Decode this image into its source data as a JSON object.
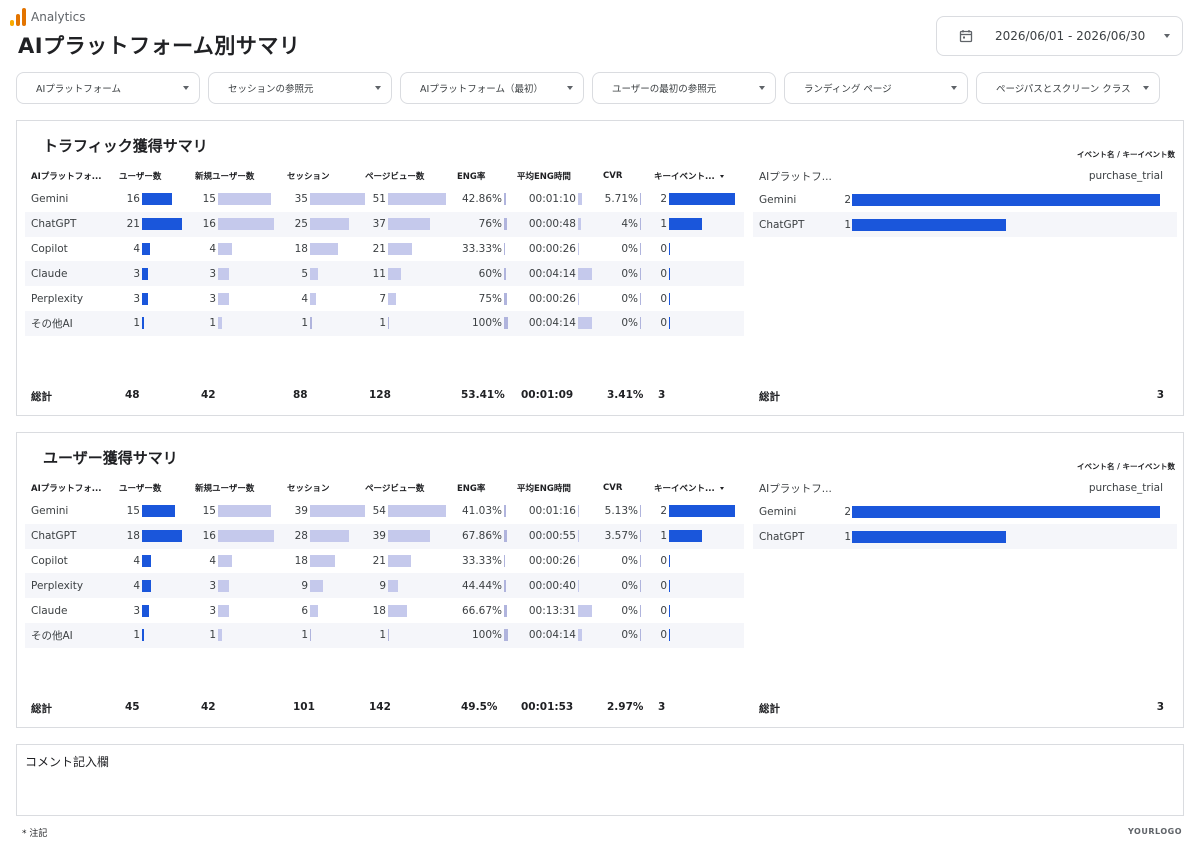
{
  "app": {
    "name": "Analytics"
  },
  "page": {
    "title": "AIプラットフォーム別サマリ"
  },
  "date_range": {
    "value": "2026/06/01 - 2026/06/30"
  },
  "filters": [
    "AIプラットフォーム",
    "セッションの参照元",
    "AIプラットフォーム（最初）",
    "ユーザーの最初の参照元",
    "ランディング ページ",
    "ページパスとスクリーン クラス"
  ],
  "columns": [
    "AIプラットフォ...",
    "ユーザー数",
    "新規ユーザー数",
    "セッション",
    "ページビュー数",
    "ENG率",
    "平均ENG時間",
    "CVR",
    "キーイベント..."
  ],
  "side_header": {
    "event_title": "イベント名 / キーイベント数",
    "col1": "AIプラットフ...",
    "col2": "purchase_trial"
  },
  "sections": [
    {
      "title": "トラフィック獲得サマリ",
      "rows": [
        {
          "name": "Gemini",
          "users": 16,
          "new_users": 15,
          "sessions": 35,
          "pageviews": 51,
          "eng_rate": "42.86%",
          "eng_rate_value": 42.86,
          "avg_time": "00:01:10",
          "avg_time_sec": 70,
          "cvr": "5.71%",
          "cvr_value": 5.71,
          "key_events": 2
        },
        {
          "name": "ChatGPT",
          "users": 21,
          "new_users": 16,
          "sessions": 25,
          "pageviews": 37,
          "eng_rate": "76%",
          "eng_rate_value": 76,
          "avg_time": "00:00:48",
          "avg_time_sec": 48,
          "cvr": "4%",
          "cvr_value": 4,
          "key_events": 1
        },
        {
          "name": "Copilot",
          "users": 4,
          "new_users": 4,
          "sessions": 18,
          "pageviews": 21,
          "eng_rate": "33.33%",
          "eng_rate_value": 33.33,
          "avg_time": "00:00:26",
          "avg_time_sec": 26,
          "cvr": "0%",
          "cvr_value": 0,
          "key_events": 0
        },
        {
          "name": "Claude",
          "users": 3,
          "new_users": 3,
          "sessions": 5,
          "pageviews": 11,
          "eng_rate": "60%",
          "eng_rate_value": 60,
          "avg_time": "00:04:14",
          "avg_time_sec": 254,
          "cvr": "0%",
          "cvr_value": 0,
          "key_events": 0
        },
        {
          "name": "Perplexity",
          "users": 3,
          "new_users": 3,
          "sessions": 4,
          "pageviews": 7,
          "eng_rate": "75%",
          "eng_rate_value": 75,
          "avg_time": "00:00:26",
          "avg_time_sec": 26,
          "cvr": "0%",
          "cvr_value": 0,
          "key_events": 0
        },
        {
          "name": "その他AI",
          "users": 1,
          "new_users": 1,
          "sessions": 1,
          "pageviews": 1,
          "eng_rate": "100%",
          "eng_rate_value": 100,
          "avg_time": "00:04:14",
          "avg_time_sec": 254,
          "cvr": "0%",
          "cvr_value": 0,
          "key_events": 0
        }
      ],
      "totals": {
        "label": "総計",
        "users": "48",
        "new_users": "42",
        "sessions": "88",
        "pageviews": "128",
        "eng_rate": "53.41%",
        "avg_time": "00:01:09",
        "cvr": "3.41%",
        "key_events": "3"
      },
      "side_rows": [
        {
          "name": "Gemini",
          "value": 2
        },
        {
          "name": "ChatGPT",
          "value": 1
        }
      ],
      "side_total": {
        "label": "総計",
        "value": "3"
      }
    },
    {
      "title": "ユーザー獲得サマリ",
      "rows": [
        {
          "name": "Gemini",
          "users": 15,
          "new_users": 15,
          "sessions": 39,
          "pageviews": 54,
          "eng_rate": "41.03%",
          "eng_rate_value": 41.03,
          "avg_time": "00:01:16",
          "avg_time_sec": 76,
          "cvr": "5.13%",
          "cvr_value": 5.13,
          "key_events": 2
        },
        {
          "name": "ChatGPT",
          "users": 18,
          "new_users": 16,
          "sessions": 28,
          "pageviews": 39,
          "eng_rate": "67.86%",
          "eng_rate_value": 67.86,
          "avg_time": "00:00:55",
          "avg_time_sec": 55,
          "cvr": "3.57%",
          "cvr_value": 3.57,
          "key_events": 1
        },
        {
          "name": "Copilot",
          "users": 4,
          "new_users": 4,
          "sessions": 18,
          "pageviews": 21,
          "eng_rate": "33.33%",
          "eng_rate_value": 33.33,
          "avg_time": "00:00:26",
          "avg_time_sec": 26,
          "cvr": "0%",
          "cvr_value": 0,
          "key_events": 0
        },
        {
          "name": "Perplexity",
          "users": 4,
          "new_users": 3,
          "sessions": 9,
          "pageviews": 9,
          "eng_rate": "44.44%",
          "eng_rate_value": 44.44,
          "avg_time": "00:00:40",
          "avg_time_sec": 40,
          "cvr": "0%",
          "cvr_value": 0,
          "key_events": 0
        },
        {
          "name": "Claude",
          "users": 3,
          "new_users": 3,
          "sessions": 6,
          "pageviews": 18,
          "eng_rate": "66.67%",
          "eng_rate_value": 66.67,
          "avg_time": "00:13:31",
          "avg_time_sec": 811,
          "cvr": "0%",
          "cvr_value": 0,
          "key_events": 0
        },
        {
          "name": "その他AI",
          "users": 1,
          "new_users": 1,
          "sessions": 1,
          "pageviews": 1,
          "eng_rate": "100%",
          "eng_rate_value": 100,
          "avg_time": "00:04:14",
          "avg_time_sec": 254,
          "cvr": "0%",
          "cvr_value": 0,
          "key_events": 0
        }
      ],
      "totals": {
        "label": "総計",
        "users": "45",
        "new_users": "42",
        "sessions": "101",
        "pageviews": "142",
        "eng_rate": "49.5%",
        "avg_time": "00:01:53",
        "cvr": "2.97%",
        "key_events": "3"
      },
      "side_rows": [
        {
          "name": "Gemini",
          "value": 2
        },
        {
          "name": "ChatGPT",
          "value": 1
        }
      ],
      "side_total": {
        "label": "総計",
        "value": "3"
      }
    }
  ],
  "comment": {
    "label": "コメント記入欄"
  },
  "footer": {
    "note": "* 注記",
    "logo": "YOURLOGO"
  },
  "colors": {
    "bar_dark": "#1a56db",
    "bar_light": "#c5c9ec"
  }
}
